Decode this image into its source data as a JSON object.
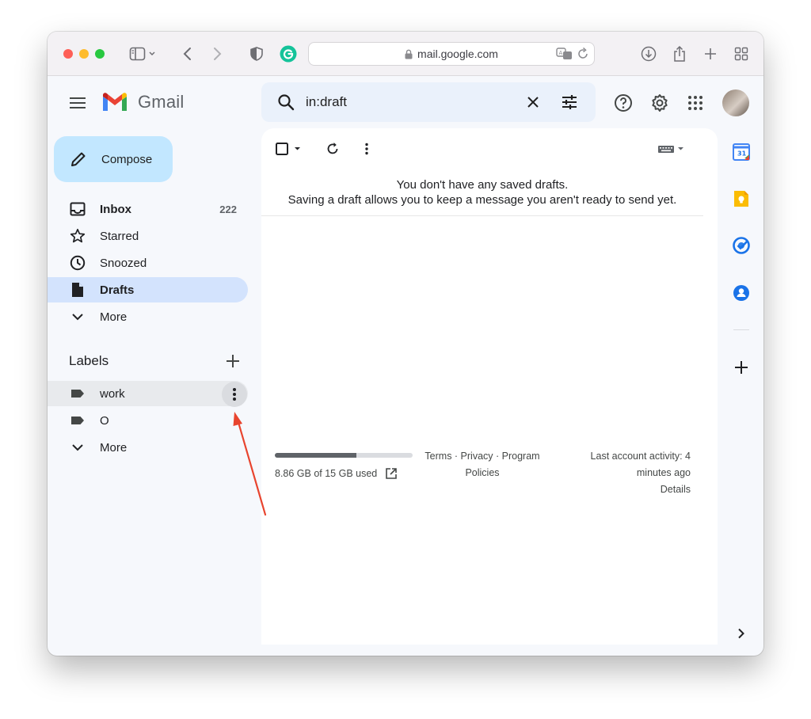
{
  "browser": {
    "url": "mail.google.com"
  },
  "gmail": {
    "logo_text": "Gmail",
    "search_query": "in:draft",
    "compose_label": "Compose",
    "nav": [
      {
        "label": "Inbox",
        "count": "222"
      },
      {
        "label": "Starred"
      },
      {
        "label": "Snoozed"
      },
      {
        "label": "Drafts"
      },
      {
        "label": "More"
      }
    ],
    "labels_title": "Labels",
    "labels": [
      {
        "label": "work"
      },
      {
        "label": "O"
      }
    ],
    "labels_more": "More"
  },
  "main": {
    "empty_line1": "You don't have any saved drafts.",
    "empty_line2": "Saving a draft allows you to keep a message you aren't ready to send yet.",
    "storage_text": "8.86 GB of 15 GB used",
    "storage_used_fraction": 0.59,
    "footer_links_line1": "Terms · Privacy · Program",
    "footer_links_line2": "Policies",
    "activity_line1": "Last account activity: 4",
    "activity_line2": "minutes ago",
    "activity_line3": "Details"
  },
  "colors": {
    "accent": "#c2e7ff",
    "active_nav": "#d3e3fd",
    "annotation": "#e8442e"
  },
  "icons": [
    "sidebar-icon",
    "back-icon",
    "forward-icon",
    "shield-icon",
    "grammarly-icon",
    "lock-icon",
    "translate-icon",
    "reload-icon",
    "download-icon",
    "share-icon",
    "new-tab-icon",
    "tab-overview-icon",
    "menu-icon",
    "search-icon",
    "clear-icon",
    "filter-icon",
    "help-icon",
    "gear-icon",
    "apps-icon",
    "pencil-icon",
    "inbox-icon",
    "star-icon",
    "clock-icon",
    "draft-icon",
    "chevron-down-icon",
    "plus-icon",
    "label-icon",
    "more-vert-icon",
    "checkbox-icon",
    "refresh-icon",
    "keyboard-icon",
    "external-link-icon",
    "calendar-icon",
    "keep-icon",
    "tasks-icon",
    "contacts-icon",
    "chevron-right-icon"
  ]
}
